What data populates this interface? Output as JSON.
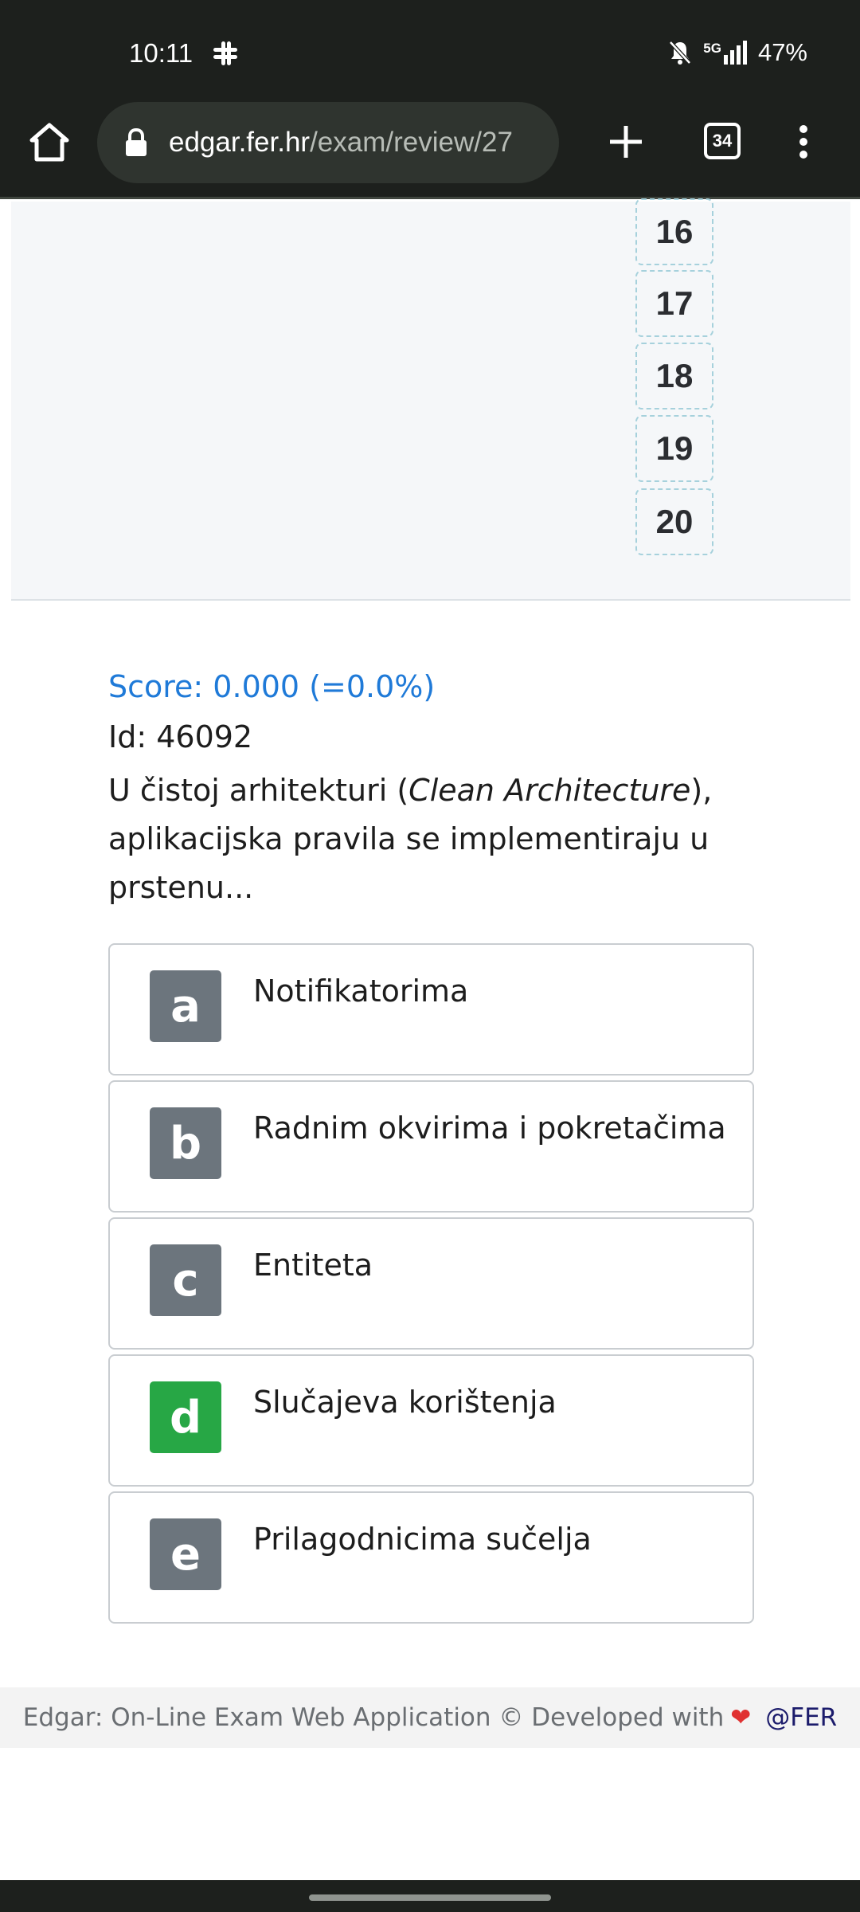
{
  "status_bar": {
    "time": "10:11",
    "network": "5G",
    "battery": "47%"
  },
  "browser": {
    "url_domain": "edgar.fer.hr",
    "url_path": "/exam/review/27",
    "tab_count": "34"
  },
  "question_nav": {
    "numbers": [
      "16",
      "17",
      "18",
      "19",
      "20"
    ]
  },
  "question": {
    "score": "Score: 0.000 (=0.0%)",
    "id": "Id: 46092",
    "text_before": "U čistoj arhitekturi (",
    "text_em": "Clean Architecture",
    "text_after": "), aplikacijska pravila se implementiraju u prstenu...",
    "answers": [
      {
        "letter": "a",
        "text": "Notifikatorima",
        "correct": false
      },
      {
        "letter": "b",
        "text": "Radnim okvirima i pokretačima",
        "correct": false
      },
      {
        "letter": "c",
        "text": "Entiteta",
        "correct": false
      },
      {
        "letter": "d",
        "text": "Slučajeva korištenja",
        "correct": true
      },
      {
        "letter": "e",
        "text": "Prilagodnicima sučelja",
        "correct": false
      }
    ]
  },
  "footer": {
    "text": "Edgar: On-Line Exam Web Application © Developed with",
    "heart": "❤",
    "link": "@FER"
  },
  "colors": {
    "accent_blue": "#1f7ad8",
    "correct_green": "#27a745",
    "letter_gray": "#6c757d"
  }
}
